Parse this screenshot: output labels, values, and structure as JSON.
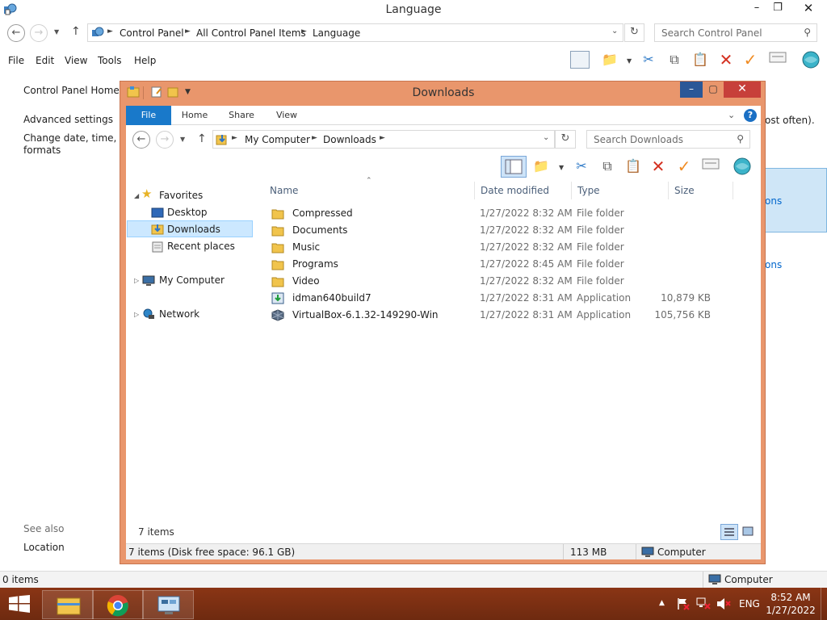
{
  "control_panel": {
    "title": "Language",
    "breadcrumbs": [
      "Control Panel",
      "All Control Panel Items",
      "Language"
    ],
    "search_placeholder": "Search Control Panel",
    "menu": [
      "File",
      "Edit",
      "View",
      "Tools",
      "Help"
    ],
    "sidebar": {
      "home": "Control Panel Home",
      "advanced": "Advanced settings",
      "change_date_1": "Change date, time, or n",
      "change_date_2": "formats",
      "see_also": "See also",
      "location": "Location"
    },
    "partial_text_right": "ost often).",
    "partial_link_1": "ons",
    "partial_link_2": "ons",
    "status_items": "0 items",
    "status_computer": "Computer"
  },
  "downloads": {
    "title": "Downloads",
    "tabs": [
      "File",
      "Home",
      "Share",
      "View"
    ],
    "breadcrumbs": [
      "My Computer",
      "Downloads"
    ],
    "search_placeholder": "Search Downloads",
    "nav": {
      "favorites": "Favorites",
      "desktop": "Desktop",
      "downloads": "Downloads",
      "recent": "Recent places",
      "computer": "My Computer",
      "network": "Network"
    },
    "columns": [
      "Name",
      "Date modified",
      "Type",
      "Size"
    ],
    "files": [
      {
        "name": "Compressed",
        "date": "1/27/2022 8:32 AM",
        "type": "File folder",
        "size": "",
        "kind": "folder"
      },
      {
        "name": "Documents",
        "date": "1/27/2022 8:32 AM",
        "type": "File folder",
        "size": "",
        "kind": "folder"
      },
      {
        "name": "Music",
        "date": "1/27/2022 8:32 AM",
        "type": "File folder",
        "size": "",
        "kind": "folder"
      },
      {
        "name": "Programs",
        "date": "1/27/2022 8:45 AM",
        "type": "File folder",
        "size": "",
        "kind": "folder"
      },
      {
        "name": "Video",
        "date": "1/27/2022 8:32 AM",
        "type": "File folder",
        "size": "",
        "kind": "folder"
      },
      {
        "name": "idman640build7",
        "date": "1/27/2022 8:31 AM",
        "type": "Application",
        "size": "10,879 KB",
        "kind": "app"
      },
      {
        "name": "VirtualBox-6.1.32-149290-Win",
        "date": "1/27/2022 8:31 AM",
        "type": "Application",
        "size": "105,756 KB",
        "kind": "vbox"
      }
    ],
    "count": "7 items",
    "status_left": "7 items (Disk free space: 96.1 GB)",
    "status_size": "113 MB",
    "status_computer": "Computer"
  },
  "taskbar": {
    "lang": "ENG",
    "time": "8:52 AM",
    "date": "1/27/2022"
  }
}
